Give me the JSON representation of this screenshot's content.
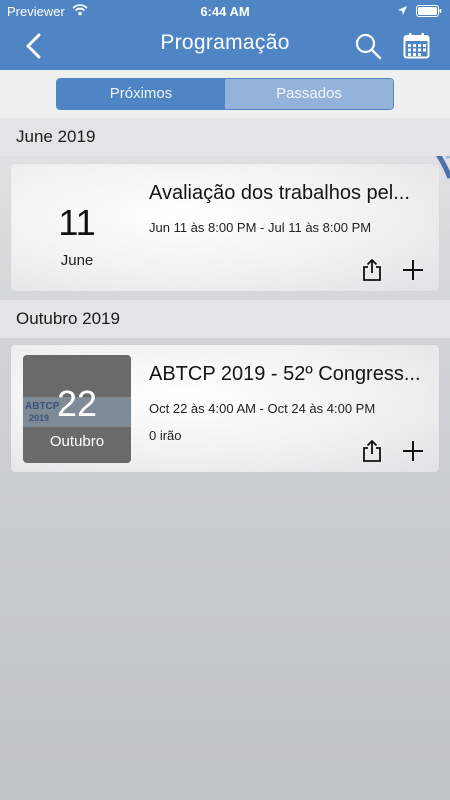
{
  "status": {
    "carrier": "Previewer",
    "time": "6:44 AM"
  },
  "nav": {
    "title": "Programação"
  },
  "tabs": [
    {
      "label": "Próximos",
      "active": true
    },
    {
      "label": "Passados",
      "active": false
    }
  ],
  "sections": [
    {
      "header": "June 2019",
      "events": [
        {
          "day": "11",
          "month": "June",
          "title": "Avaliação dos trabalhos pel...",
          "time": "Jun 11 às 8:00 PM - Jul 11 às 8:00 PM"
        }
      ]
    },
    {
      "header": "Outubro 2019",
      "events": [
        {
          "day": "22",
          "month": "Outubro",
          "title": "ABTCP 2019 - 52º Congress...",
          "time": "Oct 22 às 4:00 AM - Oct 24 às 4:00 PM",
          "attending": "0 irão",
          "thumbnail_text": [
            "ABTCP",
            "2019"
          ]
        }
      ]
    }
  ],
  "colors": {
    "brand": "#4f85c4",
    "tab_inactive": "#93b3da",
    "background": "#c2c3c6"
  }
}
